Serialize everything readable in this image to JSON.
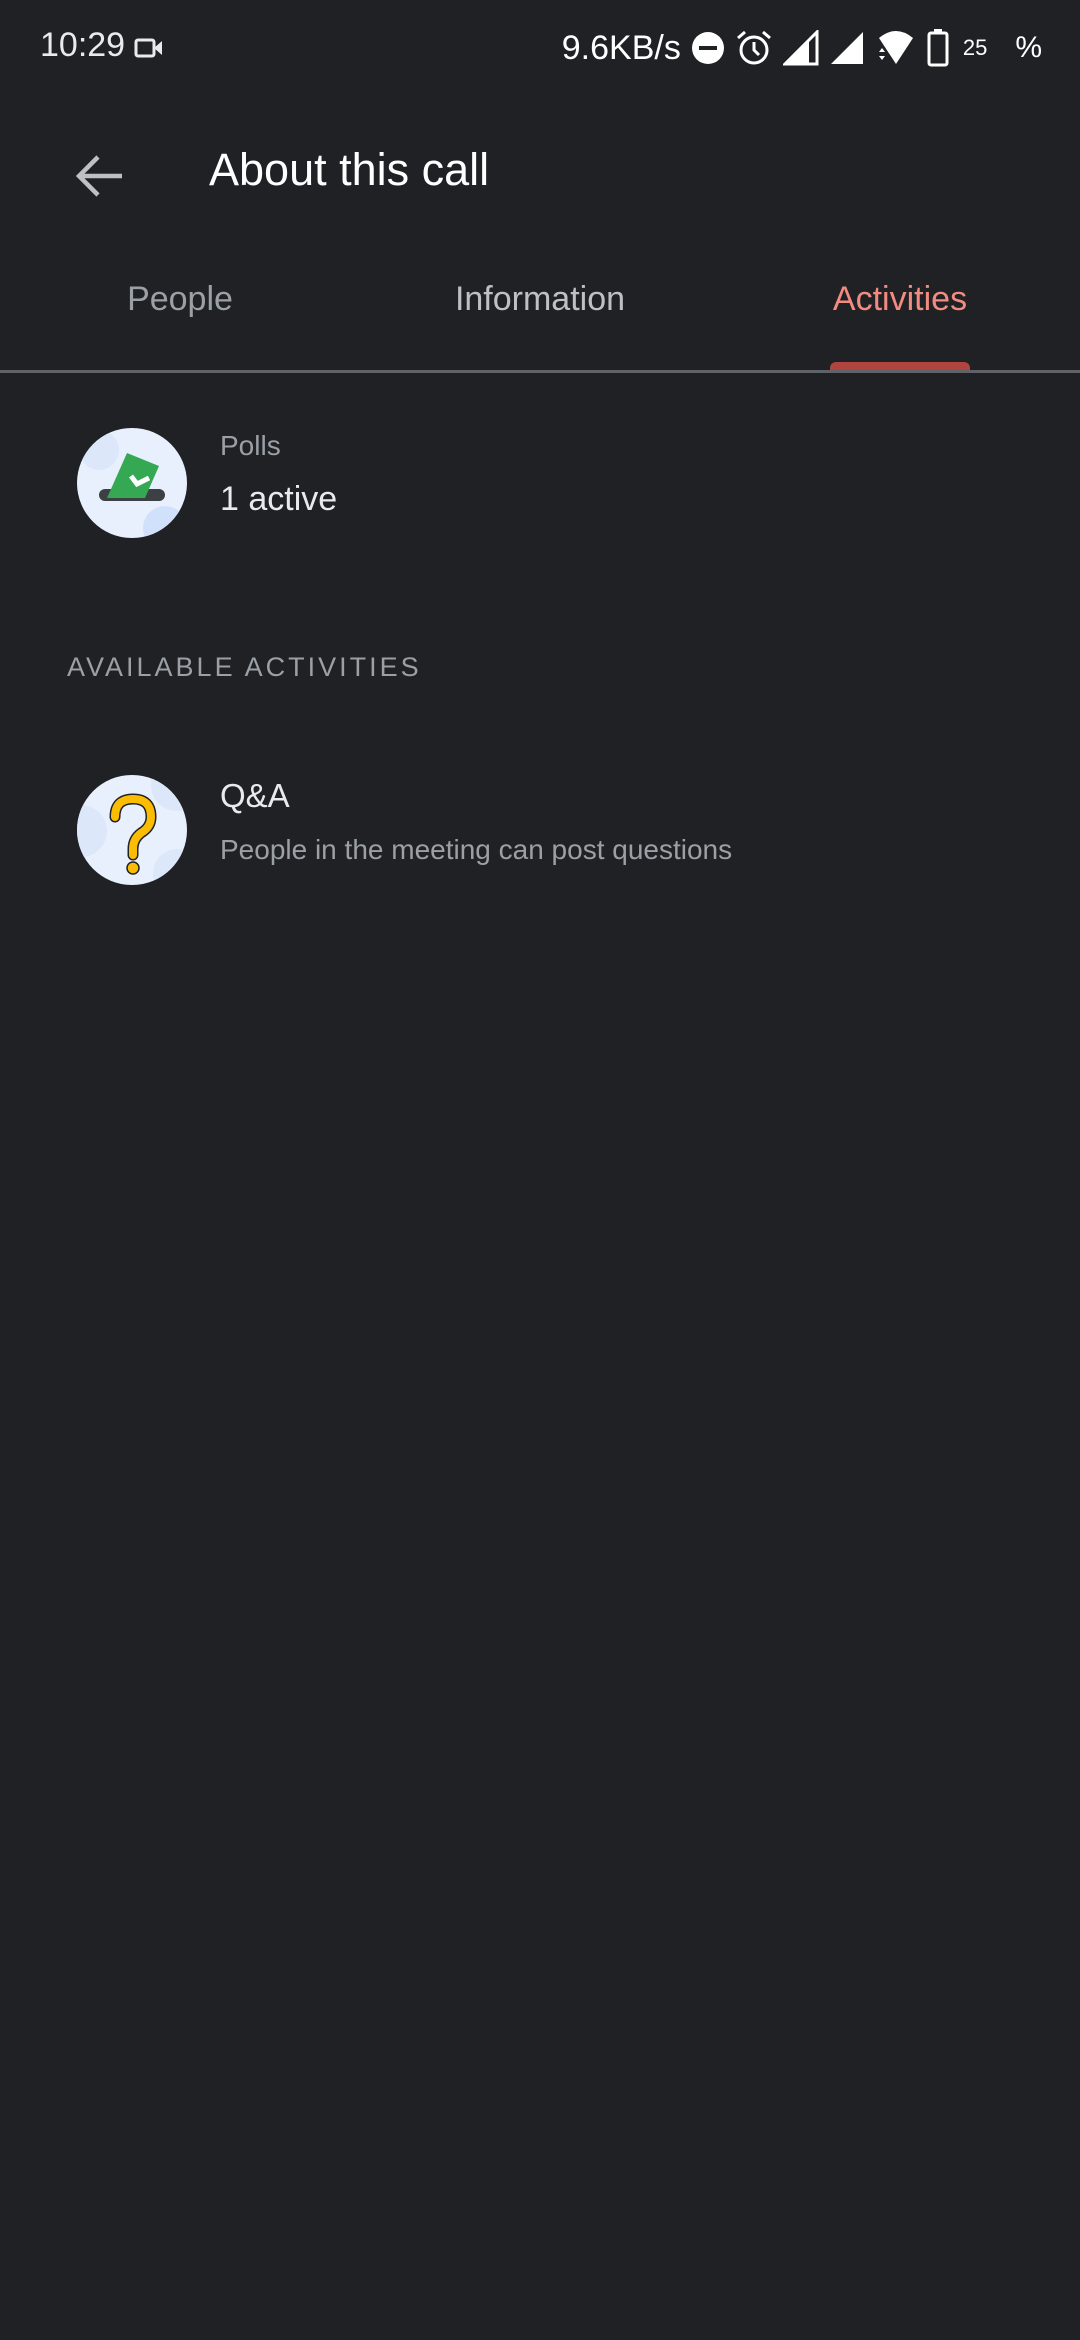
{
  "status_bar": {
    "time": "10:29",
    "network_speed": "9.6KB/s",
    "battery_level": "25",
    "battery_suffix": "%",
    "icons": [
      "video-camera-icon",
      "do-not-disturb-icon",
      "alarm-icon",
      "signal-icon",
      "signal-icon",
      "wifi-icon",
      "battery-icon"
    ]
  },
  "app_bar": {
    "back_icon": "arrow-back-icon",
    "title": "About this call"
  },
  "tabs": [
    {
      "label": "People",
      "selected": false
    },
    {
      "label": "Information",
      "selected": false
    },
    {
      "label": "Activities",
      "selected": true
    }
  ],
  "colors": {
    "background": "#202124",
    "accent": "#f28b82",
    "indicator": "#b0443f"
  },
  "polls": {
    "icon": "poll-ballot-icon",
    "label": "Polls",
    "status": "1 active"
  },
  "available_section": {
    "heading": "AVAILABLE ACTIVITIES",
    "items": [
      {
        "icon": "question-mark-icon",
        "title": "Q&A",
        "description": "People in the meeting can post questions"
      }
    ]
  }
}
